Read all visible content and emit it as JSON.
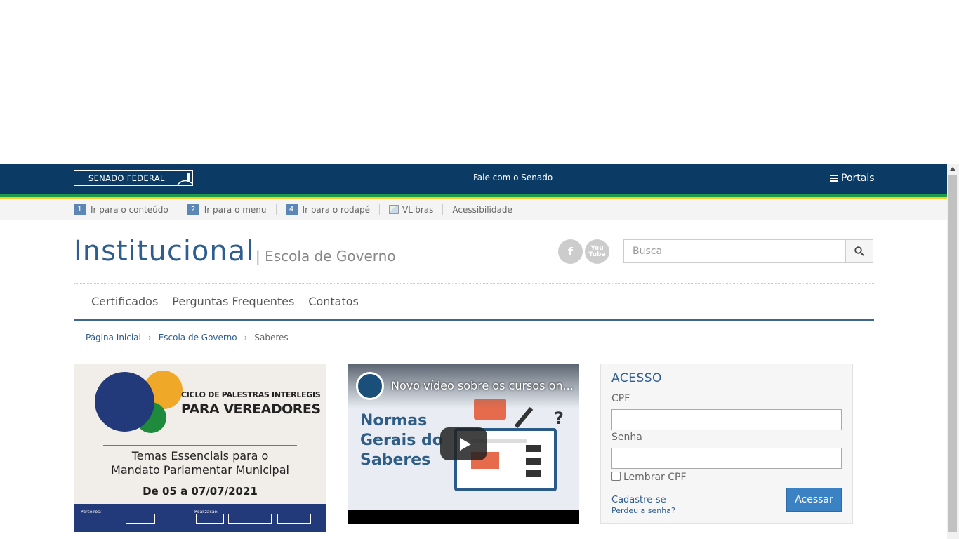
{
  "topbar": {
    "senado_label": "SENADO FEDERAL",
    "fale_label": "Fale com o Senado",
    "portais_label": "Portais"
  },
  "accessibility": {
    "items": [
      {
        "num": "1",
        "label": "Ir para o conteúdo"
      },
      {
        "num": "2",
        "label": "Ir para o menu"
      },
      {
        "num": "4",
        "label": "Ir para o rodapé"
      }
    ],
    "vlibras_label": "VLibras",
    "acessibilidade_label": "Acessibilidade"
  },
  "header": {
    "title": "Institucional",
    "subtitle": "| Escola de Governo",
    "social": {
      "facebook": "f",
      "youtube": "You Tube"
    },
    "search_placeholder": "Busca"
  },
  "nav": [
    "Certificados",
    "Perguntas Frequentes",
    "Contatos"
  ],
  "breadcrumb": [
    "Página Inicial",
    "Escola de Governo",
    "Saberes"
  ],
  "banner": {
    "line1": "CICLO DE PALESTRAS INTERLEGIS",
    "line2": "PARA VEREADORES",
    "line3": "Temas Essenciais para o",
    "line4": "Mandato Parlamentar Municipal",
    "line5": "De 05 a 07/07/2021",
    "parceiros": "Parceiros:",
    "realizacao": "Realização:"
  },
  "video": {
    "title": "Novo vídeo sobre os cursos on...",
    "big_text": [
      "Normas",
      "Gerais do",
      "Saberes"
    ]
  },
  "login": {
    "title": "ACESSO",
    "cpf_label": "CPF",
    "senha_label": "Senha",
    "remember_label": "Lembrar CPF",
    "cadastre_label": "Cadastre-se",
    "perdeu_label": "Perdeu a senha?",
    "submit_label": "Acessar"
  },
  "colors": {
    "topbar": "#0b3a64",
    "green_stripe": "#1f9a48",
    "yellow_stripe": "#f4d22a",
    "accent": "#2e5e8f",
    "button": "#3b82c4"
  }
}
